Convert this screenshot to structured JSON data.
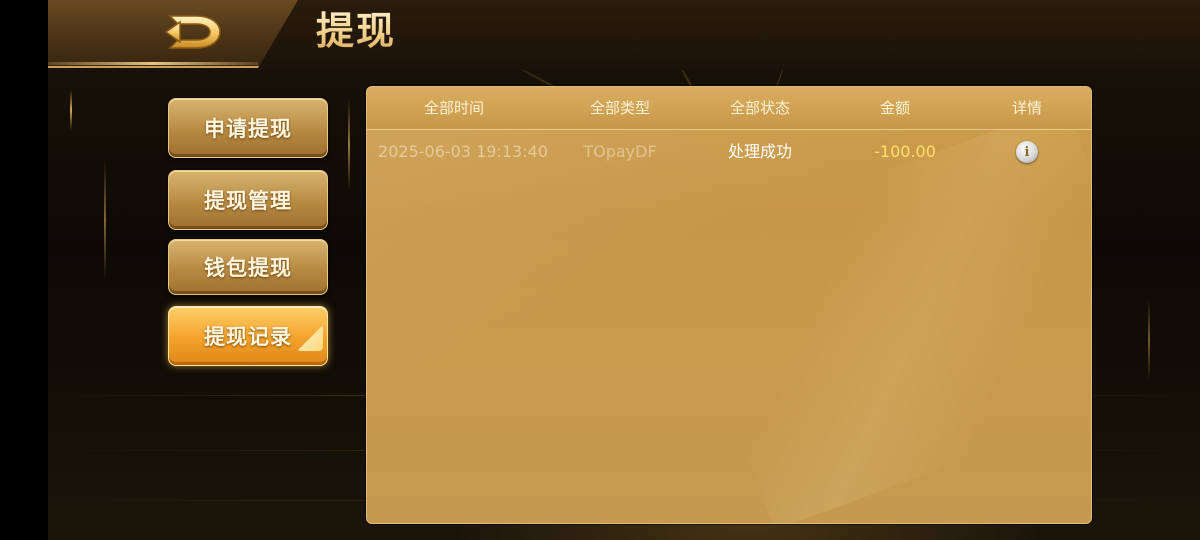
{
  "header": {
    "title": "提现",
    "back_icon": "back-arrow-icon"
  },
  "menu": {
    "items": [
      {
        "label": "申请提现",
        "active": false
      },
      {
        "label": "提现管理",
        "active": false
      },
      {
        "label": "钱包提现",
        "active": false
      },
      {
        "label": "提现记录",
        "active": true
      }
    ]
  },
  "table": {
    "columns": [
      "全部时间",
      "全部类型",
      "全部状态",
      "金额",
      "详情"
    ],
    "rows": [
      {
        "time": "2025-06-03 19:13:40",
        "type": "TOpayDF",
        "status": "处理成功",
        "amount": "-100.00",
        "detail_icon": "info-icon"
      }
    ]
  },
  "colors": {
    "accent_gold": "#c99a4a",
    "amount": "#ffe06a",
    "active_button": "#f2a22a"
  }
}
